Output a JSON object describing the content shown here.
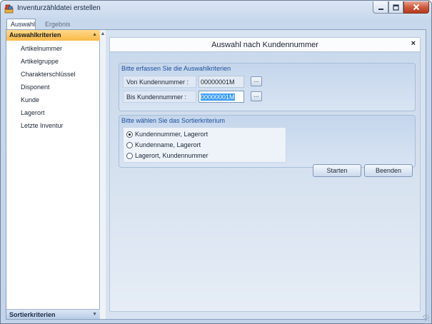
{
  "window": {
    "title": "Inventurzähldatei erstellen",
    "icons": {
      "app": "app-icon",
      "minimize": "minimize-icon",
      "maximize": "maximize-icon",
      "close": "close-icon"
    }
  },
  "tabs": [
    {
      "label": "Auswahl",
      "active": true
    },
    {
      "label": "Ergebnis",
      "active": false
    }
  ],
  "nav": {
    "header": "Auswahlkriterien",
    "items": [
      "Artikelnummer",
      "Artikelgruppe",
      "Charakterschlüssel",
      "Disponent",
      "Kunde",
      "Lagerort",
      "Letzte Inventur"
    ],
    "footer": "Sortierkriterien",
    "header_icon": "chevron-up-icon",
    "footer_icon": "chevron-down-icon"
  },
  "panel": {
    "title": "Auswahl nach Kundennummer",
    "close": "×",
    "criteria_group": {
      "title": "Bitte erfassen Sie die Auswahlkriterien",
      "from_label": "Von Kundennummer :",
      "from_value": "00000001M",
      "to_label": "Bis Kundennummer :",
      "to_value": "00000001M",
      "lookup": "..."
    },
    "sort_group": {
      "title": "Bitte wählen Sie das Sortierkriterium",
      "options": [
        {
          "label": "Kundennummer, Lagerort",
          "checked": true
        },
        {
          "label": "Kundenname, Lagerort",
          "checked": false
        },
        {
          "label": "Lagerort, Kundennummer",
          "checked": false
        }
      ]
    },
    "buttons": {
      "start": "Starten",
      "end": "Beenden"
    }
  },
  "colors": {
    "nav_header": "#f8b948",
    "accent_text": "#1d4f9c",
    "selection": "#3399ff"
  }
}
